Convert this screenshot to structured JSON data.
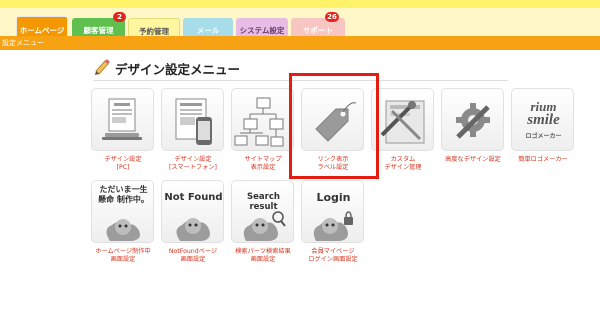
{
  "nav": {
    "tabs": [
      {
        "label": "ホームページ"
      },
      {
        "label": "顧客管理"
      },
      {
        "label": "予約管理"
      },
      {
        "label": "メール"
      },
      {
        "label": "システム設定"
      },
      {
        "label": "サポート"
      }
    ],
    "badges": {
      "customer": "2",
      "support": "26"
    }
  },
  "breadcrumb": "設定メニュー",
  "page": {
    "title": "デザイン設定メニュー"
  },
  "menu": [
    {
      "line1": "デザイン設定",
      "line2": "[PC]",
      "icon": "pc-design-icon"
    },
    {
      "line1": "デザイン設定",
      "line2": "[スマートフォン]",
      "icon": "smartphone-design-icon"
    },
    {
      "line1": "サイトマップ",
      "line2": "表示設定",
      "icon": "sitemap-icon"
    },
    {
      "line1": "リンク表示",
      "line2": "ラベル設定",
      "icon": "tag-label-icon"
    },
    {
      "line1": "カスタム",
      "line2": "デザイン管理",
      "icon": "custom-design-icon"
    },
    {
      "line1": "高度なデザイン設定",
      "line2": "",
      "icon": "gear-wrench-icon"
    },
    {
      "line1": "簡単ロゴメーカー",
      "line2": "",
      "icon": "logo-maker-icon",
      "art": {
        "top": "rium",
        "mid": "smile",
        "bottom": "ロゴメーカー"
      }
    },
    {
      "line1": "ホームページ制作中",
      "line2": "画面設定",
      "icon": "under-construction-icon",
      "art": {
        "text": "ただいま一生懸命 制作中。"
      }
    },
    {
      "line1": "NotFoundページ",
      "line2": "画面設定",
      "icon": "not-found-icon",
      "art": {
        "text": "Not Found"
      }
    },
    {
      "line1": "検索パーツ検索結果",
      "line2": "画面設定",
      "icon": "search-result-icon",
      "art": {
        "text": "Search result"
      }
    },
    {
      "line1": "会員マイページ",
      "line2": "ログイン画面設定",
      "icon": "login-icon",
      "art": {
        "text": "Login"
      }
    }
  ],
  "colors": {
    "orange": "#f7a213",
    "caption": "#d8321c",
    "highlight": "#e51c10"
  }
}
